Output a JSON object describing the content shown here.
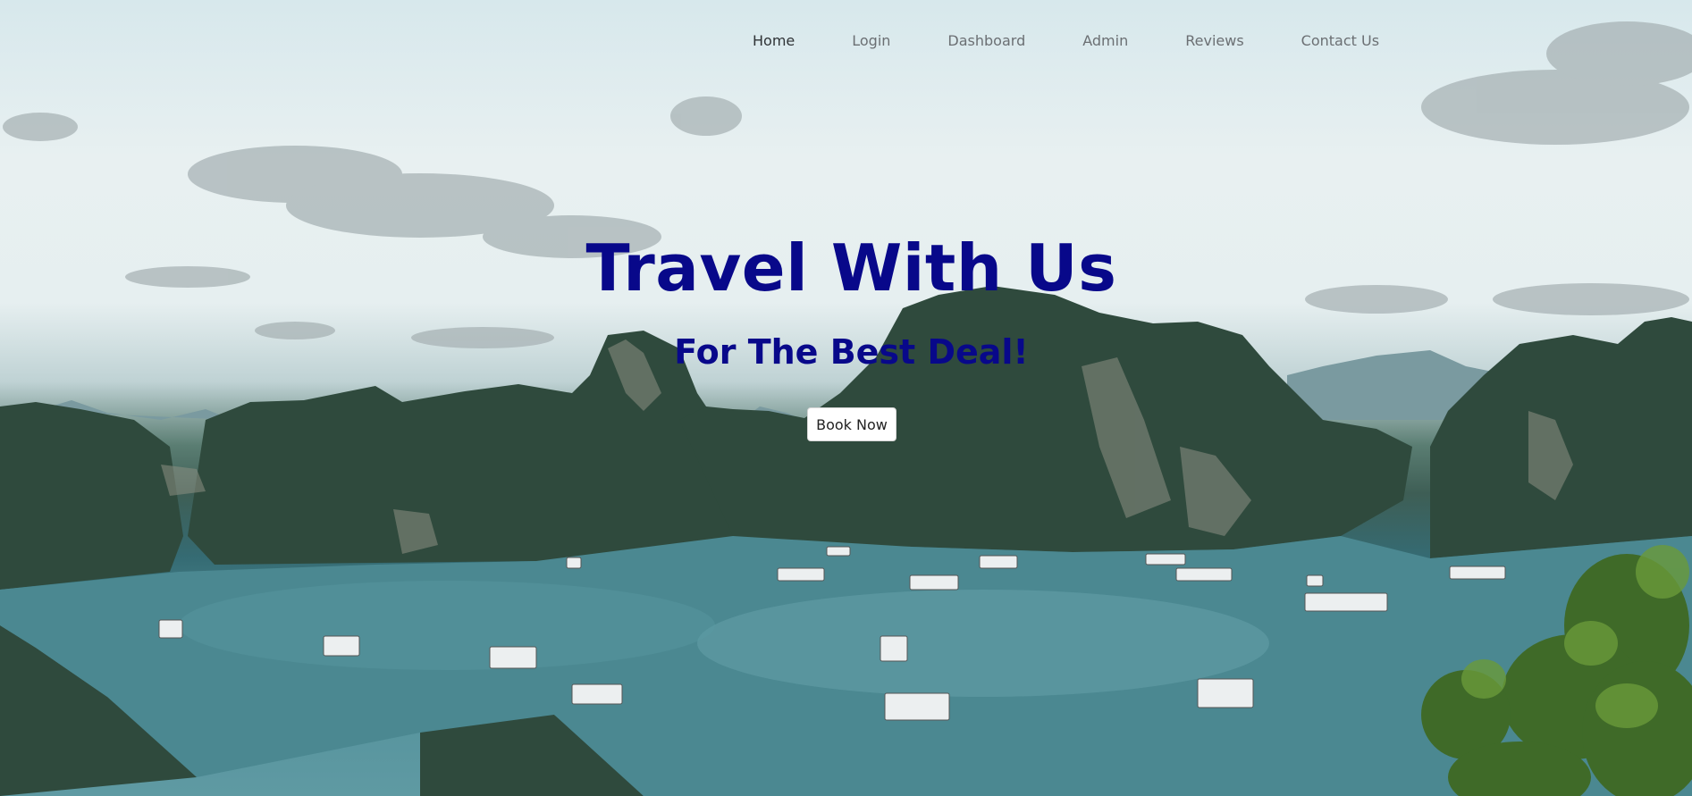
{
  "nav": {
    "items": [
      {
        "label": "Home",
        "active": true
      },
      {
        "label": "Login",
        "active": false
      },
      {
        "label": "Dashboard",
        "active": false
      },
      {
        "label": "Admin",
        "active": false
      },
      {
        "label": "Reviews",
        "active": false
      },
      {
        "label": "Contact Us",
        "active": false
      }
    ]
  },
  "hero": {
    "title": "Travel With Us",
    "subtitle": "For The Best Deal!",
    "cta_label": "Book Now"
  },
  "colors": {
    "heading": "#08088a",
    "nav_text": "#6b6f73",
    "nav_active": "#2f3336",
    "button_bg": "#ffffff"
  },
  "background": {
    "description_icon": "landscape-bay-photo"
  }
}
